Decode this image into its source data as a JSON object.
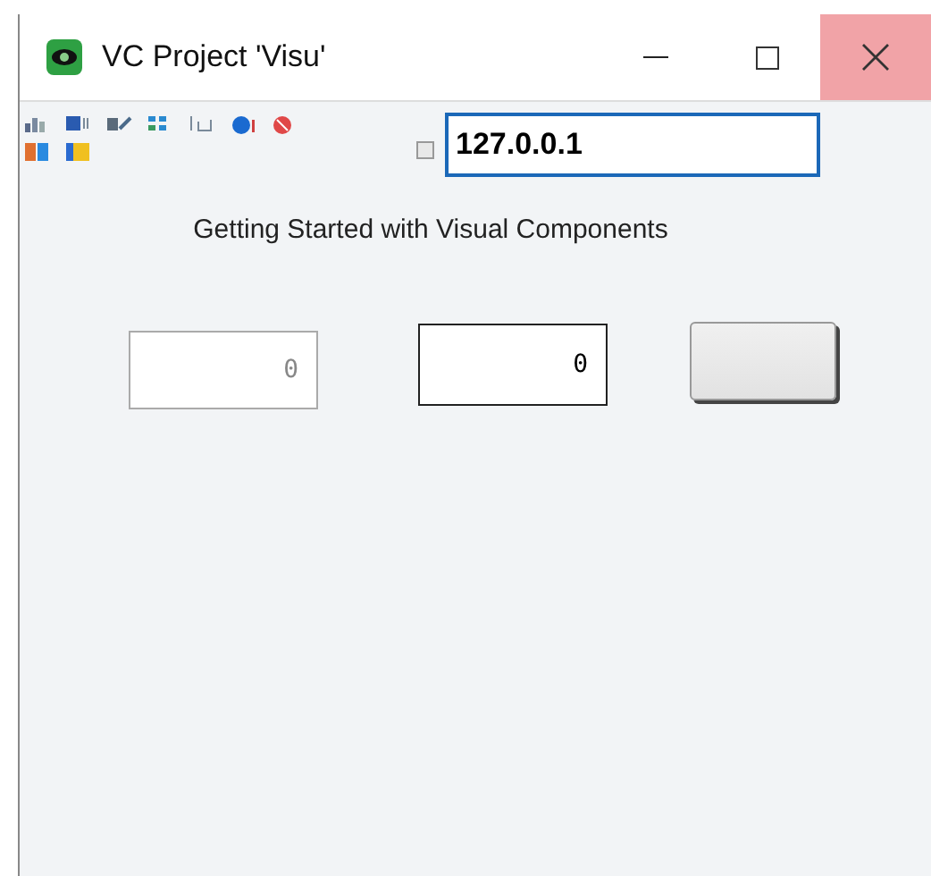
{
  "window": {
    "title": "VC Project 'Visu'"
  },
  "toolbar": {
    "checkbox": {
      "checked": false
    },
    "address": {
      "value": "127.0.0.1"
    }
  },
  "heading": "Getting Started with Visual Components",
  "fields": [
    {
      "value": "0",
      "disabled": true
    },
    {
      "value": "0",
      "disabled": false
    }
  ]
}
